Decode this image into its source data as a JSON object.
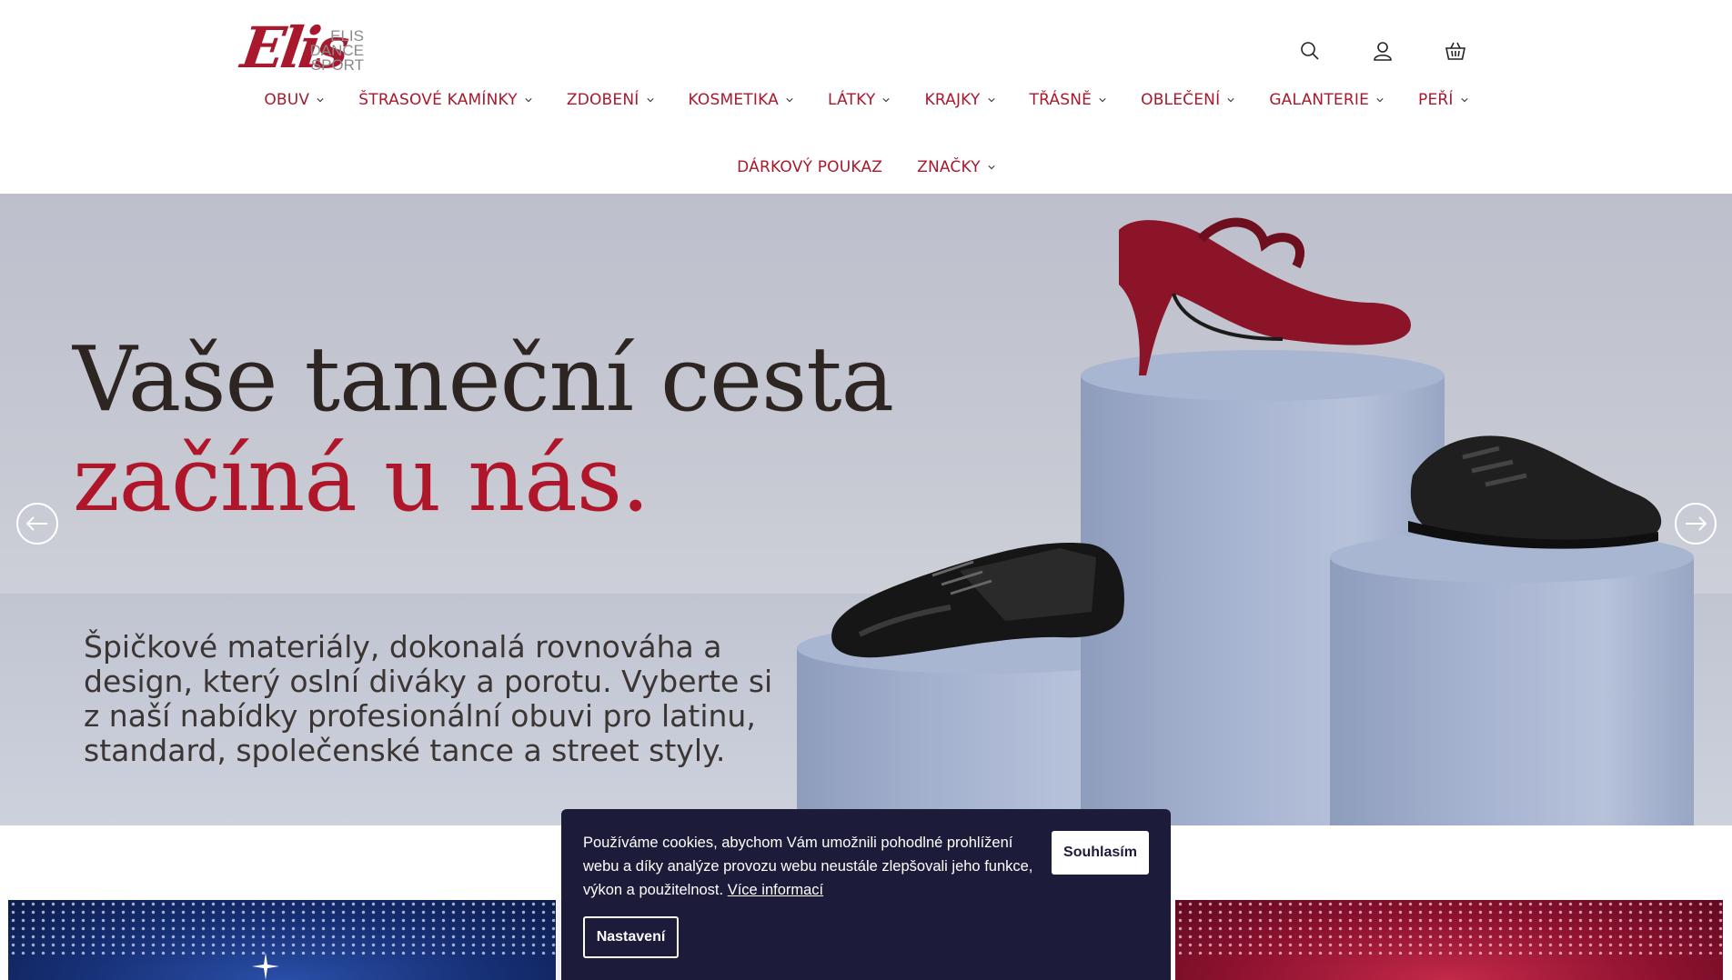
{
  "brand": {
    "script": "Elis",
    "line1": "ELIS",
    "line2": "DANCE",
    "line3": "SPORT"
  },
  "header_icons": [
    "search-icon",
    "user-icon",
    "basket-icon"
  ],
  "nav": {
    "row1": [
      "OBUV",
      "ŠTRASOVÉ KAMÍNKY",
      "ZDOBENÍ",
      "KOSMETIKA",
      "LÁTKY",
      "KRAJKY",
      "TŘÁSNĚ",
      "OBLEČENÍ",
      "GALANTERIE",
      "PEŘÍ"
    ],
    "row2": [
      "DÁRKOVÝ POUKAZ",
      "ZNAČKY"
    ]
  },
  "hero": {
    "title_line1": "Vaše taneční cesta",
    "title_line2": "začíná u nás.",
    "text": "Špičkové materiály, dokonalá rovnováha a design, který oslní diváky a porotu. Vyberte si z naší nabídky profesionální obuvi pro latinu, standard, společenské tance a street styly."
  },
  "cookie": {
    "text": "Používáme cookies, abychom Vám umožnili pohodlné prohlížení webu a díky analýze provozu webu neustále zlepšovali jeho funkce, výkon a použitelnost.",
    "link": "Více informací",
    "accept": "Souhlasím",
    "settings": "Nastavení"
  },
  "colors": {
    "brand": "#a8192e",
    "cookie_bg": "#1d1b3a"
  }
}
